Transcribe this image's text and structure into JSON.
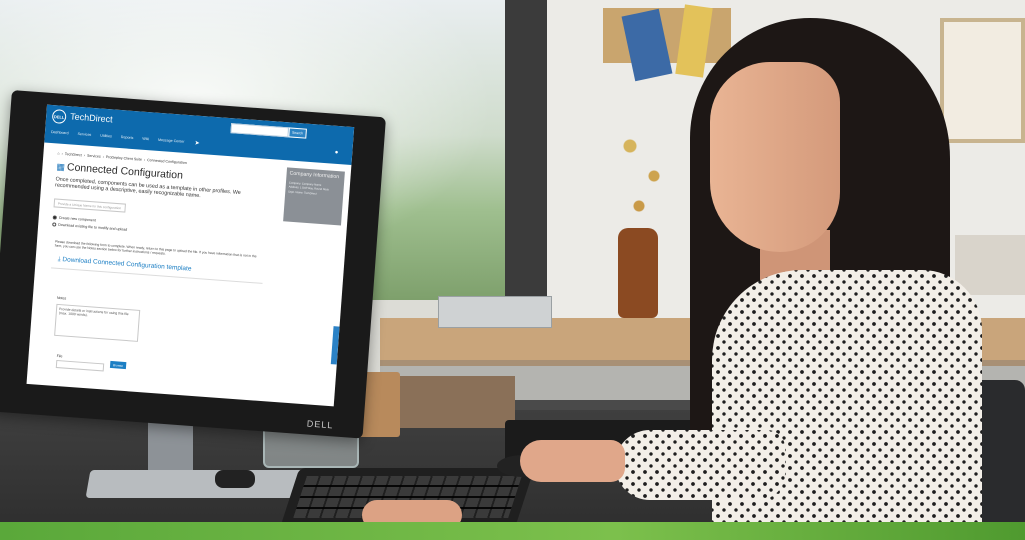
{
  "app": {
    "brand": "TechDirect",
    "logo_text": "DELL",
    "search_button": "Search",
    "nav": [
      "Dashboard",
      "Services",
      "Utilities",
      "Reports",
      "Wiki",
      "Message Center"
    ]
  },
  "page": {
    "breadcrumb": [
      "TechDirect",
      "Services",
      "ProDeploy Client Suite",
      "Connected Configuration"
    ],
    "title": "Connected Configuration",
    "description": "Once completed, components can be used as a template in other profiles. We recommended using a descriptive, easily recognizable name.",
    "name_placeholder": "Provide a Unique Name for this configuration",
    "radio_options": [
      {
        "label": "Create new component",
        "selected": true
      },
      {
        "label": "Download existing file to modify and upload",
        "selected": false
      }
    ],
    "instructions": "Please download the following form to complete. When ready, return to this page to upload the file. If you have information that is not in the form, you can use the Notes section below for further instructions / requests.",
    "download_link": "Download Connected Configuration template",
    "notes_label": "Notes",
    "notes_placeholder": "Provide details or instructions for using this file (max. 1000 words).",
    "file_label": "File",
    "file_button": "Browse"
  },
  "company_card": {
    "title": "Company Information",
    "lines": [
      "Company: Company Name",
      "Address: 1 Dell Way, Round Rock",
      "Dept. Name: TechDirect"
    ]
  },
  "monitor_brand": "DELL",
  "colors": {
    "header_blue": "#0d6aad",
    "link_blue": "#1d7fc4",
    "card_gray": "#8b9096",
    "banner_green": "#5aa83a"
  },
  "icons": {
    "breadcrumb_home": "home-icon",
    "title_icon": "configuration-icon",
    "download": "download-icon",
    "user": "user-icon",
    "cursor": "mouse-cursor-icon"
  }
}
